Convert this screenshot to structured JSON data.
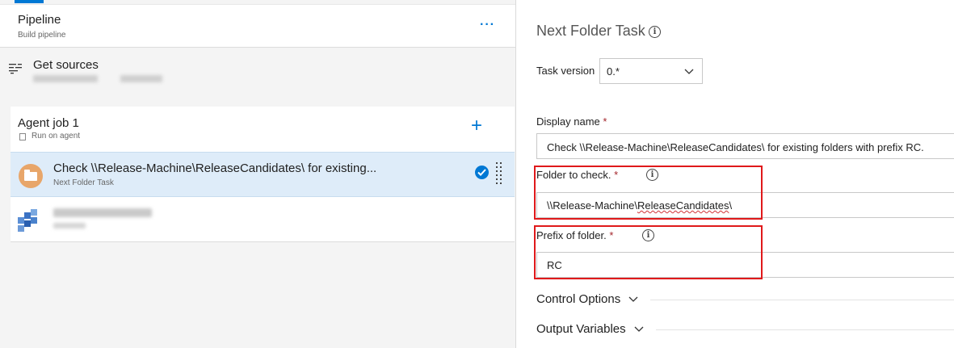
{
  "left": {
    "pipeline": {
      "title": "Pipeline",
      "subtitle": "Build pipeline",
      "more": "···"
    },
    "sources": {
      "title": "Get sources"
    },
    "job": {
      "title": "Agent job 1",
      "subtitle": "Run on agent",
      "add": "+"
    },
    "tasks": [
      {
        "title": "Check \\\\Release-Machine\\ReleaseCandidates\\ for existing...",
        "subtitle": "Next Folder Task",
        "selected": true
      }
    ]
  },
  "right": {
    "title": "Next Folder Task",
    "task_version": {
      "label": "Task version",
      "value": "0.*"
    },
    "display_name": {
      "label": "Display name",
      "value": "Check \\\\Release-Machine\\ReleaseCandidates\\ for existing folders with prefix RC."
    },
    "folder_to_check": {
      "label": "Folder to check.",
      "value_prefix": "\\\\Release-Machine\\",
      "value_squiggle": "ReleaseCandidates",
      "value_suffix": "\\"
    },
    "prefix": {
      "label": "Prefix of folder.",
      "value": "RC"
    },
    "sections": {
      "control_options": "Control Options",
      "output_variables": "Output Variables"
    },
    "required_mark": "*",
    "info_glyph": "i"
  },
  "colors": {
    "accent": "#0078d4",
    "selected_bg": "#deecf9",
    "highlight_box": "#e0191b",
    "task_icon": "#e8a66a"
  }
}
